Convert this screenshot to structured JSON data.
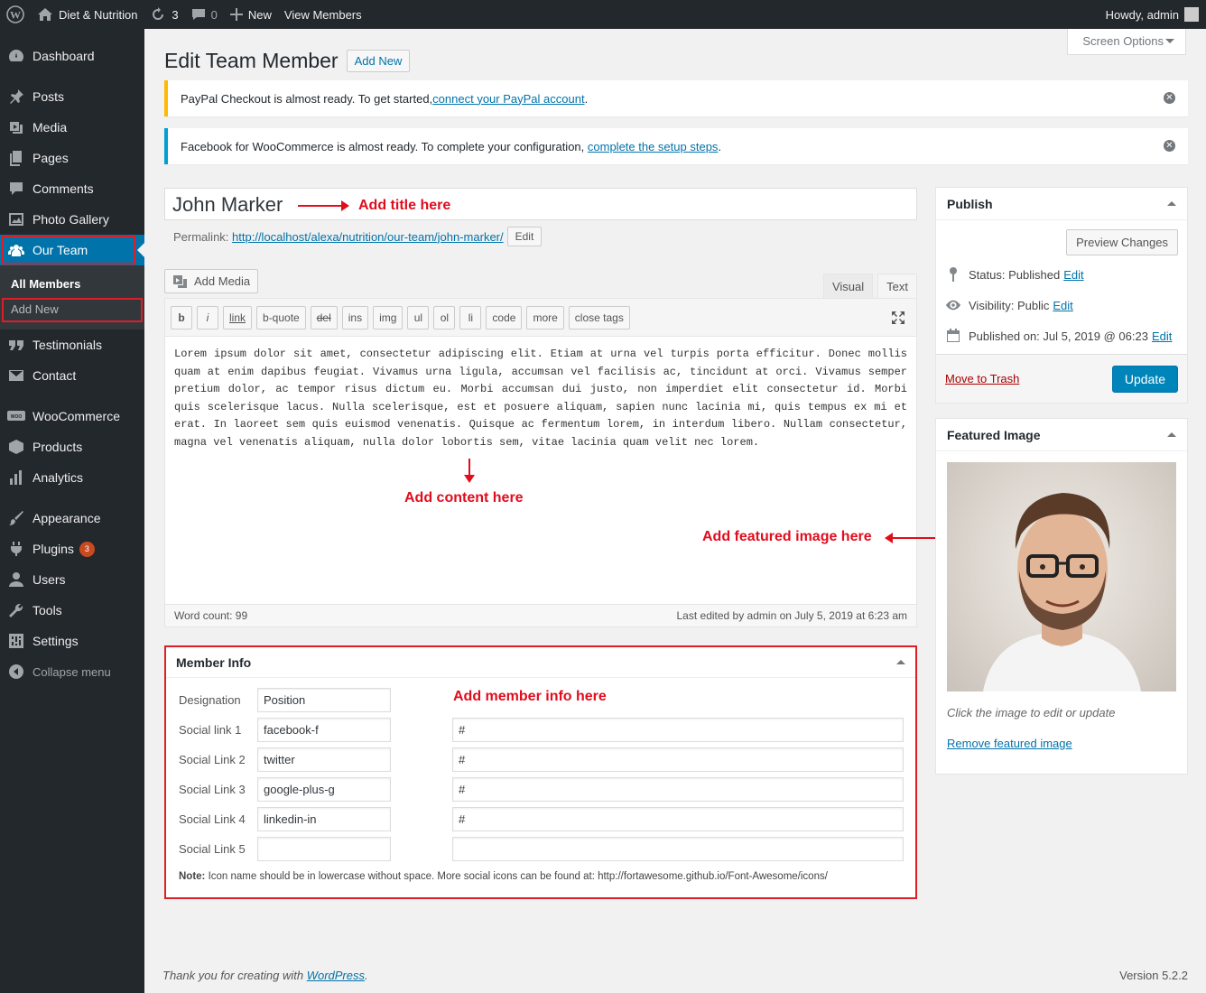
{
  "adminbar": {
    "site_name": "Diet & Nutrition",
    "updates_count": "3",
    "comments_count": "0",
    "new_label": "New",
    "view_label": "View Members",
    "howdy": "Howdy, admin"
  },
  "sidebar": {
    "items": [
      {
        "label": "Dashboard"
      },
      {
        "label": "Posts"
      },
      {
        "label": "Media"
      },
      {
        "label": "Pages"
      },
      {
        "label": "Comments"
      },
      {
        "label": "Photo Gallery"
      },
      {
        "label": "Our Team"
      },
      {
        "label": "Testimonials"
      },
      {
        "label": "Contact"
      },
      {
        "label": "WooCommerce"
      },
      {
        "label": "Products"
      },
      {
        "label": "Analytics"
      },
      {
        "label": "Appearance"
      },
      {
        "label": "Plugins"
      },
      {
        "label": "Users"
      },
      {
        "label": "Tools"
      },
      {
        "label": "Settings"
      },
      {
        "label": "Collapse menu"
      }
    ],
    "submenu": [
      "All Members",
      "Add New"
    ],
    "plugins_badge": "3"
  },
  "header": {
    "screen_options": "Screen Options",
    "title": "Edit Team Member",
    "add_new": "Add New"
  },
  "notices": {
    "paypal_text": "PayPal Checkout is almost ready. To get started, ",
    "paypal_link": "connect your PayPal account",
    "paypal_end": ".",
    "fb_bold": "Facebook for WooCommerce is almost ready.",
    "fb_text": " To complete your configuration, ",
    "fb_link": "complete the setup steps",
    "fb_end": ".",
    "accent_paypal": "#ffb900",
    "accent_fb": "#00a0d2"
  },
  "post": {
    "title": "John Marker",
    "permalink_label": "Permalink: ",
    "permalink_url": "http://localhost/alexa/nutrition/our-team/john-marker/",
    "permalink_edit": "Edit",
    "add_media": "Add Media",
    "tab_visual": "Visual",
    "tab_text": "Text",
    "toolbar": [
      "b",
      "i",
      "link",
      "b-quote",
      "del",
      "ins",
      "img",
      "ul",
      "ol",
      "li",
      "code",
      "more",
      "close tags"
    ],
    "content": "Lorem ipsum dolor sit amet, consectetur adipiscing elit. Etiam at urna vel turpis porta efficitur. Donec mollis quam at enim dapibus feugiat. Vivamus urna ligula, accumsan vel facilisis ac, tincidunt at orci. Vivamus semper pretium dolor, ac tempor risus dictum eu. Morbi accumsan dui justo, non imperdiet elit consectetur id. Morbi quis scelerisque lacus. Nulla scelerisque, est et posuere aliquam, sapien nunc lacinia mi, quis tempus ex mi et erat. In laoreet sem quis euismod venenatis. Quisque ac fermentum lorem, in interdum libero. Nullam consectetur, magna vel venenatis aliquam, nulla dolor lobortis sem, vitae lacinia quam velit nec lorem.",
    "word_count": "Word count: 99",
    "last_edited": "Last edited by admin on July 5, 2019 at 6:23 am"
  },
  "annotations": {
    "title": "Add title here",
    "content": "Add content here",
    "featured": "Add featured image here",
    "member": "Add member info here"
  },
  "member_info": {
    "heading": "Member Info",
    "rows": [
      {
        "label": "Designation",
        "value": "Position",
        "url": ""
      },
      {
        "label": "Social link 1",
        "value": "facebook-f",
        "url": "#"
      },
      {
        "label": "Social Link 2",
        "value": "twitter",
        "url": "#"
      },
      {
        "label": "Social Link 3",
        "value": "google-plus-g",
        "url": "#"
      },
      {
        "label": "Social Link 4",
        "value": "linkedin-in",
        "url": "#"
      },
      {
        "label": "Social Link 5",
        "value": "",
        "url": ""
      }
    ],
    "note_bold": "Note:",
    "note": " Icon name should be in lowercase without space. More social icons can be found at: http://fortawesome.github.io/Font-Awesome/icons/"
  },
  "publish": {
    "heading": "Publish",
    "preview": "Preview Changes",
    "status_label": "Status: ",
    "status_value": "Published",
    "visibility_label": "Visibility: ",
    "visibility_value": "Public",
    "published_label": "Published on: ",
    "published_value": "Jul 5, 2019 @ 06:23",
    "edit": "Edit",
    "trash": "Move to Trash",
    "update": "Update"
  },
  "featured": {
    "heading": "Featured Image",
    "hint": "Click the image to edit or update",
    "remove": "Remove featured image"
  },
  "footer": {
    "thanks": "Thank you for creating with ",
    "wp_link": "WordPress",
    "end": ".",
    "version": "Version 5.2.2"
  },
  "colors": {
    "admin_dark": "#23282d",
    "accent_blue": "#0073aa",
    "annotation_red": "#e00d1d"
  }
}
